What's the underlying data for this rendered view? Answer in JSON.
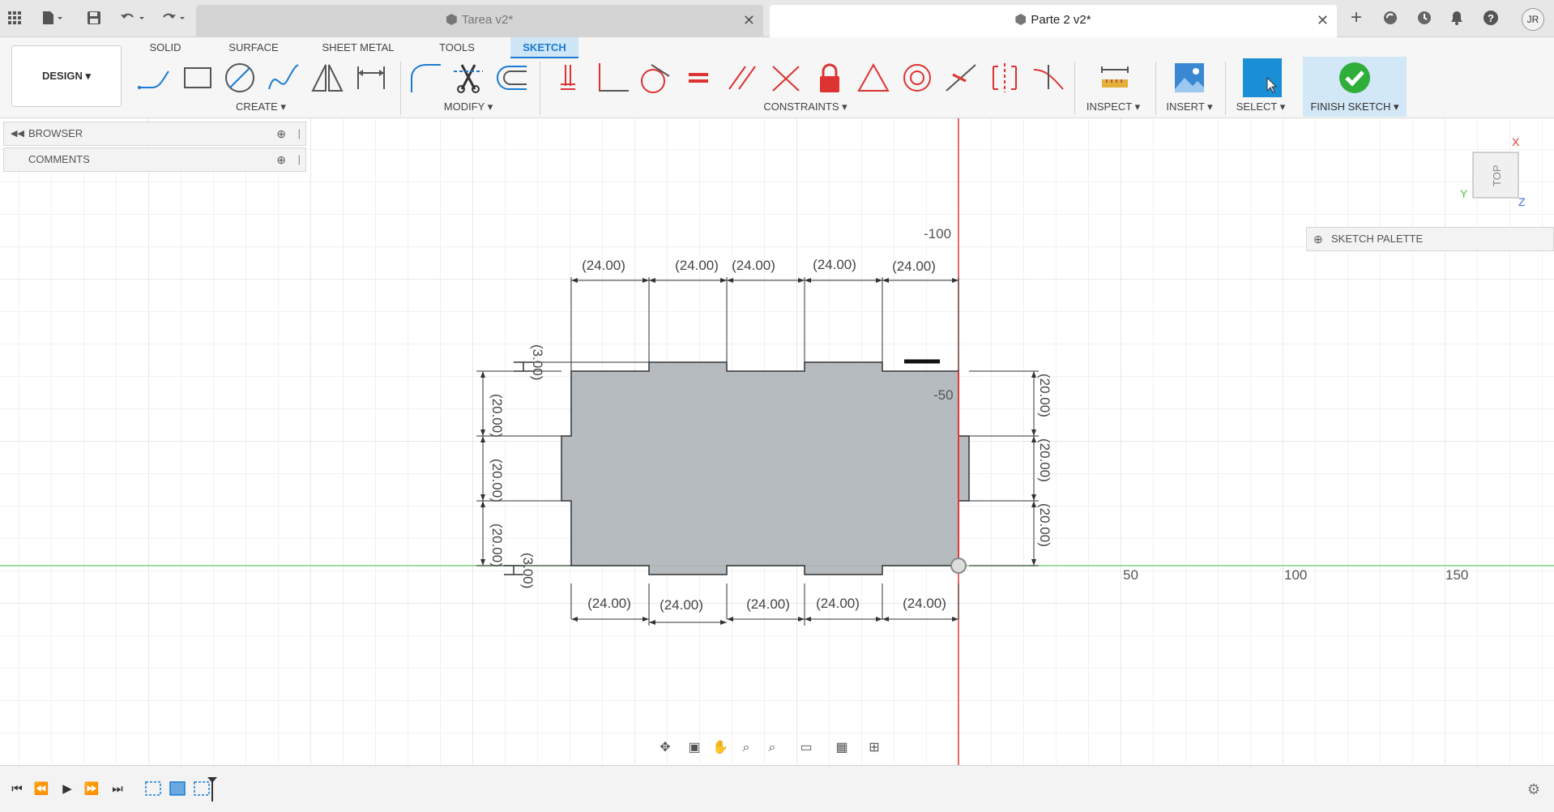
{
  "tabs": [
    {
      "label": "Tarea v2*",
      "active": false
    },
    {
      "label": "Parte 2 v2*",
      "active": true
    }
  ],
  "user_initials": "JR",
  "toolbar": {
    "design_label": "DESIGN ▾",
    "workspace_tabs": [
      "SOLID",
      "SURFACE",
      "SHEET METAL",
      "TOOLS",
      "SKETCH"
    ],
    "active_workspace": "SKETCH",
    "groups": {
      "create": "CREATE ▾",
      "modify": "MODIFY ▾",
      "constraints": "CONSTRAINTS ▾",
      "inspect": "INSPECT ▾",
      "insert": "INSERT ▾",
      "select": "SELECT ▾",
      "finish": "FINISH SKETCH ▾"
    }
  },
  "panel": {
    "browser": "BROWSER",
    "comments": "COMMENTS"
  },
  "sketch_palette": "SKETCH PALETTE",
  "viewcube": {
    "face": "TOP",
    "x": "X",
    "y": "Y",
    "z": "Z"
  },
  "axis_labels": {
    "x50": "50",
    "x100": "100",
    "x150": "150",
    "ym100": "-100",
    "ym50": "-50"
  },
  "dimensions": {
    "top": [
      "(24.00)",
      "(24.00)",
      "(24.00)",
      "(24.00)",
      "(24.00)"
    ],
    "bottom": [
      "(24.00)",
      "(24.00)",
      "(24.00)",
      "(24.00)",
      "(24.00)"
    ],
    "left": [
      "(20.00)",
      "(20.00)",
      "(20.00)"
    ],
    "right": [
      "(20.00)",
      "(20.00)",
      "(20.00)"
    ],
    "tab_top": "(3.00)",
    "tab_bottom": "(3.00)"
  },
  "colors": {
    "accent": "#1b7ad1",
    "finish": "#2fae3a",
    "x_axis": "#e03a3a",
    "y_axis": "#4fc24f",
    "profile_fill": "#aeb4b8"
  }
}
